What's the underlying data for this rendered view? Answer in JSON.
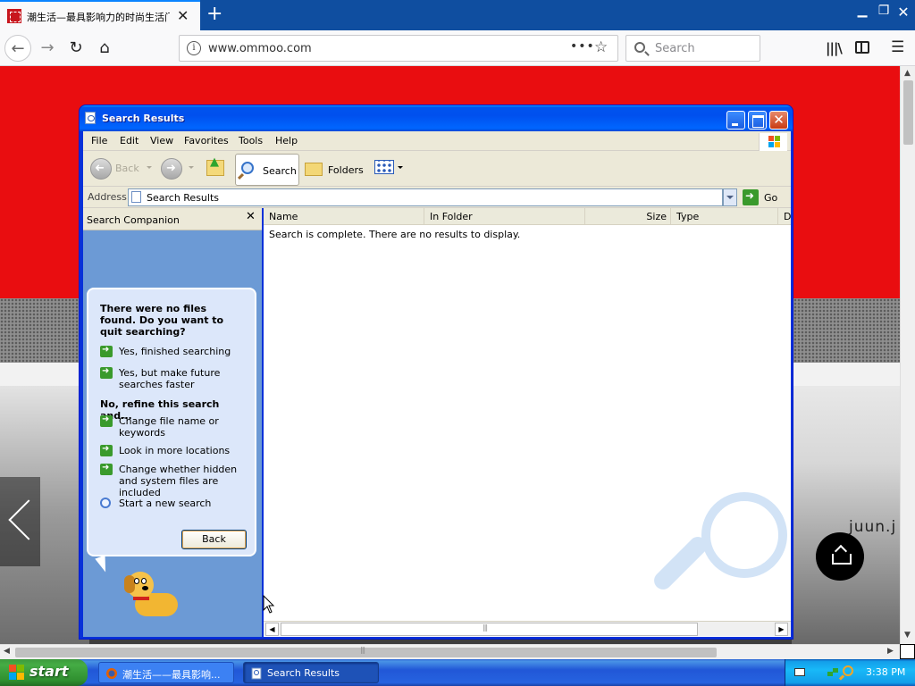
{
  "browser": {
    "tab_title": "潮生活—最具影响力的时尚生活门户网站",
    "url": "www.ommoo.com",
    "search_placeholder": "Search"
  },
  "webpage": {
    "brand_text": "juun.j"
  },
  "search_window": {
    "title": "Search Results",
    "menu": [
      "File",
      "Edit",
      "View",
      "Favorites",
      "Tools",
      "Help"
    ],
    "toolbar": {
      "back": "Back",
      "search": "Search",
      "folders": "Folders"
    },
    "address": {
      "label": "Address",
      "value": "Search Results",
      "go": "Go"
    },
    "companion": {
      "title": "Search Companion",
      "close": "✕",
      "heading1": "There were no files found. Do you want to quit searching?",
      "options1": [
        "Yes, finished searching",
        "Yes, but make future searches faster"
      ],
      "heading2": "No, refine this search and...",
      "options2": [
        "Change file name or keywords",
        "Look in more locations",
        "Change whether hidden and system files are included"
      ],
      "new_search": "Start a new search",
      "back_button": "Back"
    },
    "results": {
      "columns": [
        "Name",
        "In Folder",
        "Size",
        "Type",
        "D"
      ],
      "message": "Search is complete. There are no results to display."
    }
  },
  "taskbar": {
    "start": "start",
    "tasks": [
      "潮生活——最具影响...",
      "Search Results"
    ],
    "clock": "3:38 PM"
  },
  "colors": {
    "xp_title_blue": "#0054e3",
    "page_red": "#e90d10",
    "taskbar_blue": "#245edb",
    "start_green": "#3c9a3c"
  }
}
